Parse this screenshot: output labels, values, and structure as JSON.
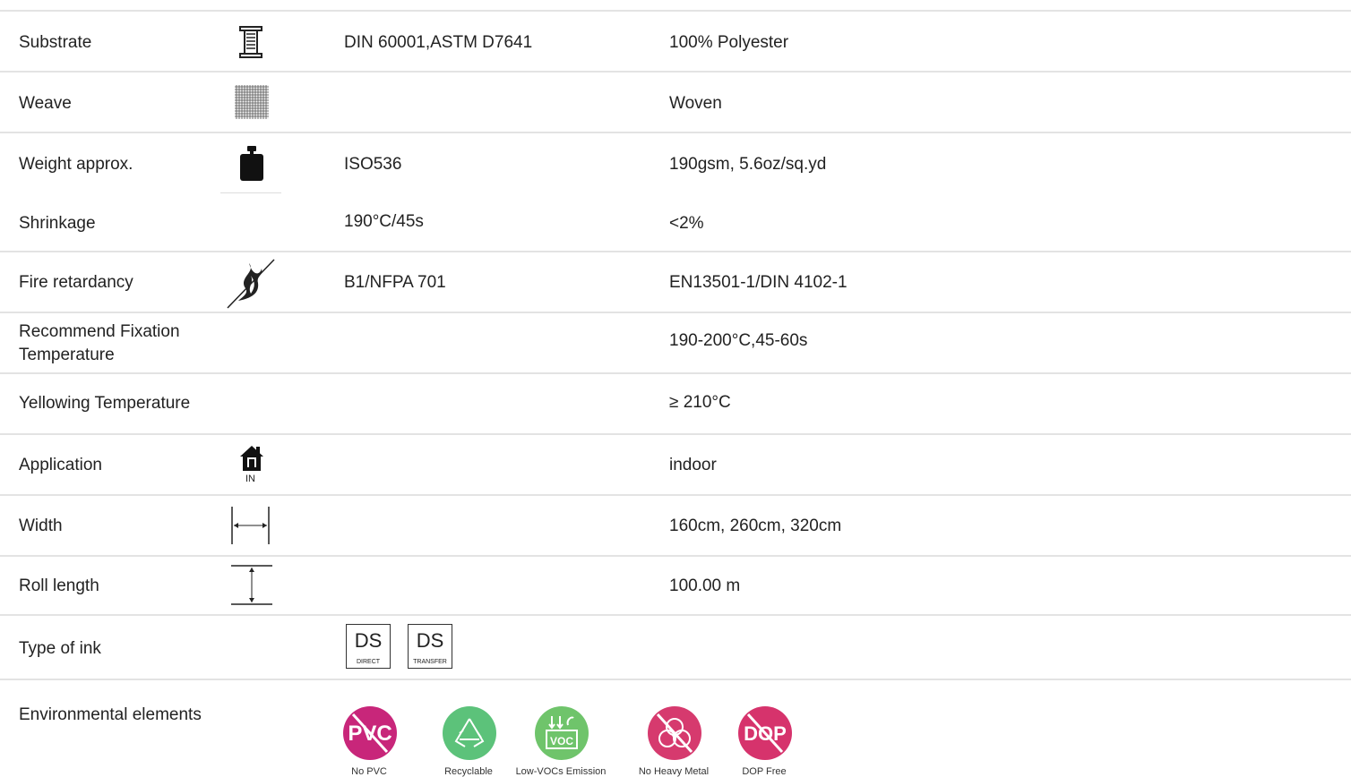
{
  "rows": [
    {
      "label": "Substrate",
      "test": "DIN 60001,ASTM D7641",
      "value": "100% Polyester",
      "icon": "spool-icon"
    },
    {
      "label": "Weave",
      "test": "",
      "value": "Woven",
      "icon": "weave-grid-icon"
    },
    {
      "label": "Weight  approx.",
      "test": "ISO536",
      "value": "190gsm, 5.6oz/sq.yd",
      "icon": "weight-icon"
    },
    {
      "label": "Shrinkage",
      "test": "190°C/45s",
      "value": "<2%",
      "icon": ""
    },
    {
      "label": "Fire retardancy",
      "test": "B1/NFPA 701",
      "value": "EN13501-1/DIN 4102-1",
      "icon": "flame-crossed-icon"
    },
    {
      "label": "Recommend Fixation",
      "label2": "Temperature",
      "test": "",
      "value": "190-200°C,45-60s",
      "icon": ""
    },
    {
      "label": "Yellowing Temperature",
      "test": "",
      "value": "≥ 210°C",
      "icon": ""
    },
    {
      "label": "Application",
      "test": "",
      "value": "indoor",
      "icon": "house-in-icon",
      "icon_text": "IN"
    },
    {
      "label": "Width",
      "test": "",
      "value": "160cm, 260cm, 320cm",
      "icon": "width-arrow-icon"
    },
    {
      "label": "Roll length",
      "test": "",
      "value": "100.00 m",
      "icon": "length-arrow-icon"
    },
    {
      "label": "Type of ink",
      "test": "",
      "value": "",
      "icon": ""
    },
    {
      "label": "Environmental elements",
      "test": "",
      "value": "",
      "icon": ""
    }
  ],
  "ink": [
    {
      "big": "DS",
      "small": "DIRECT"
    },
    {
      "big": "DS",
      "small": "TRANSFER"
    }
  ],
  "env": [
    {
      "name": "No PVC",
      "badge_text": "PVC",
      "color": "#c8267a"
    },
    {
      "name": "Recyclable",
      "badge_text": "",
      "color": "#5cc27a"
    },
    {
      "name": "Low-VOCs Emission",
      "badge_text": "VOC",
      "color": "#6fc46b"
    },
    {
      "name": "No Heavy Metal",
      "badge_text": "",
      "color": "#d63a6e"
    },
    {
      "name": "DOP Free",
      "badge_text": "DOP",
      "color": "#d6336c"
    }
  ]
}
